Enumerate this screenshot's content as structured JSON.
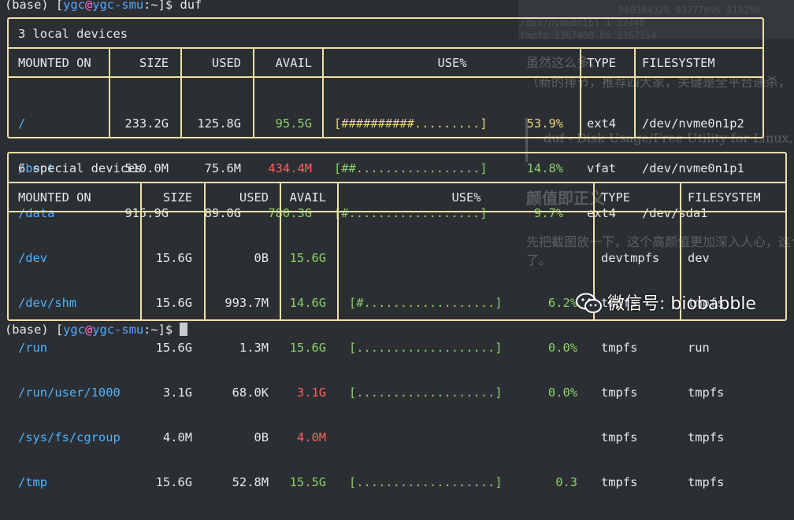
{
  "terminal": {
    "top_prompt": {
      "env": "(base) ",
      "user": "ygc",
      "at": "@",
      "host": "ygc-smu",
      "path": ":~]$ ",
      "command": "duf",
      "bracket_open": "["
    },
    "bottom_prompt": {
      "env": "(base) ",
      "user": "ygc",
      "at": "@",
      "host": "ygc-smu",
      "path": ":~]$ ",
      "bracket_open": "["
    }
  },
  "local": {
    "title": "3 local devices",
    "headers": {
      "mounted": "MOUNTED ON",
      "size": "SIZE",
      "used": "USED",
      "avail": "AVAIL",
      "use": "USE%",
      "type": "TYPE",
      "fs": "FILESYSTEM"
    },
    "rows": [
      {
        "mount": "/",
        "size": "233.2G",
        "used": "125.8G",
        "avail": "95.5G",
        "bar": "[##########.........]",
        "pct": "53.9%",
        "type": "ext4",
        "fs": "/dev/nvme0n1p2"
      },
      {
        "mount": "/boot",
        "size": "510.0M",
        "used": "75.6M",
        "avail": "434.4M",
        "bar": "[##.................]",
        "pct": "14.8%",
        "type": "vfat",
        "fs": "/dev/nvme0n1p1"
      },
      {
        "mount": "/data",
        "size": "915.9G",
        "used": "89.0G",
        "avail": "780.3G",
        "bar": "[#..................]",
        "pct": "9.7%",
        "type": "ext4",
        "fs": "/dev/sda1"
      }
    ]
  },
  "special": {
    "title": "6 special devices",
    "headers": {
      "mounted": "MOUNTED ON",
      "size": "SIZE",
      "used": "USED",
      "avail": "AVAIL",
      "use": "USE%",
      "type": "TYPE",
      "fs": "FILESYSTEM"
    },
    "rows": [
      {
        "mount": "/dev",
        "size": "15.6G",
        "used": "0B",
        "avail": "15.6G",
        "bar": "",
        "pct": "",
        "type": "devtmpfs",
        "fs": "dev"
      },
      {
        "mount": "/dev/shm",
        "size": "15.6G",
        "used": "993.7M",
        "avail": "14.6G",
        "bar": "[#..................]",
        "pct": "6.2%",
        "type": "tmpfs",
        "fs": "tmpfs"
      },
      {
        "mount": "/run",
        "size": "15.6G",
        "used": "1.3M",
        "avail": "15.6G",
        "bar": "[...................]",
        "pct": "0.0%",
        "type": "tmpfs",
        "fs": "run"
      },
      {
        "mount": "/run/user/1000",
        "size": "3.1G",
        "used": "68.0K",
        "avail": "3.1G",
        "bar": "[...................]",
        "pct": "0.0%",
        "type": "tmpfs",
        "fs": "tmpfs"
      },
      {
        "mount": "/sys/fs/cgroup",
        "size": "4.0M",
        "used": "0B",
        "avail": "4.0M",
        "bar": "",
        "pct": "",
        "type": "tmpfs",
        "fs": "tmpfs"
      },
      {
        "mount": "/tmp",
        "size": "15.6G",
        "used": "52.8M",
        "avail": "15.5G",
        "bar": "[...................]",
        "pct": "0.3",
        "type": "tmpfs",
        "fs": "tmpfs"
      }
    ]
  },
  "background": {
    "line1": "虽然这么多。",
    "line2": "（新的排节，推荐四大家，关键是全平台通杀，",
    "quote": "duf - Disk Usage/Free Utility for Linux, BSD",
    "heading": "颜值即正义",
    "line3": "先把截图放一下，这个高颜值更加深入人心，这个信",
    "line4": "了。",
    "table_row1": "960384328   93277096 818258",
    "table_row2": "/dev/nvme0n1p1   1     32448",
    "table_row3": "tmpfs   3367400   86  3367314"
  },
  "watermark": {
    "text": "微信号: biobabble"
  },
  "colors": {
    "border": "#efe0a8",
    "blue": "#4fb3ff",
    "green": "#8bcf6a",
    "red": "#ff6060",
    "yellow": "#e7d37a",
    "background": "#2b2f33"
  }
}
